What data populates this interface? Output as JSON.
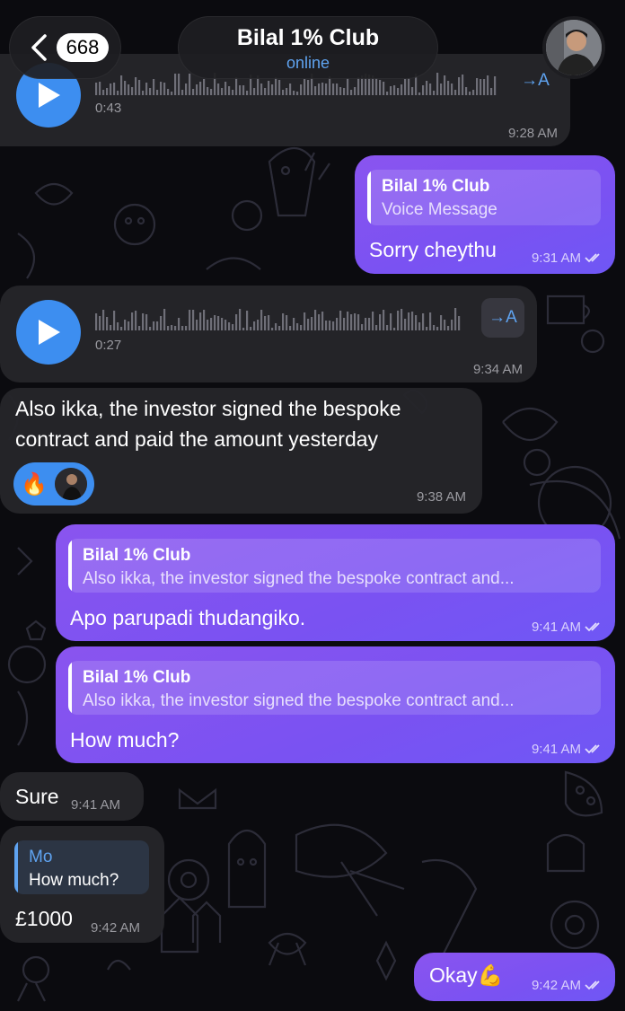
{
  "header": {
    "back_count": "668",
    "chat_title": "Bilal 1% Club",
    "status": "online"
  },
  "colors": {
    "outgoing_bubble": "#7b52f2",
    "incoming_bubble": "#25252a",
    "accent": "#3d8ef0",
    "background": "#0b0b0f"
  },
  "messages": [
    {
      "type": "voice",
      "direction": "in",
      "duration": "0:43",
      "time": "9:28 AM",
      "transcribe_label": "→A"
    },
    {
      "type": "text",
      "direction": "out",
      "reply_name": "Bilal 1% Club",
      "reply_text": "Voice Message",
      "text": "Sorry cheythu",
      "time": "9:31 AM"
    },
    {
      "type": "voice",
      "direction": "in",
      "duration": "0:27",
      "time": "9:34 AM",
      "transcribe_label": "→A"
    },
    {
      "type": "text",
      "direction": "in",
      "text_line1": "Also ikka, the investor signed the bespoke",
      "text_line2": "contract and paid the amount yesterday",
      "reaction": "🔥",
      "time": "9:38 AM"
    },
    {
      "type": "text",
      "direction": "out",
      "reply_name": "Bilal 1% Club",
      "reply_text": "Also ikka, the investor signed the bespoke contract and...",
      "text": "Apo parupadi thudangiko.",
      "time": "9:41 AM"
    },
    {
      "type": "text",
      "direction": "out",
      "reply_name": "Bilal 1% Club",
      "reply_text": "Also ikka, the investor signed the bespoke contract and...",
      "text": "How much?",
      "time": "9:41 AM"
    },
    {
      "type": "text",
      "direction": "in",
      "text": "Sure",
      "time": "9:41 AM"
    },
    {
      "type": "text",
      "direction": "in",
      "reply_name": "Mo",
      "reply_text": "How much?",
      "text": "£1000",
      "time": "9:42 AM"
    },
    {
      "type": "text",
      "direction": "out",
      "text": "Okay💪",
      "time": "9:42 AM"
    }
  ]
}
